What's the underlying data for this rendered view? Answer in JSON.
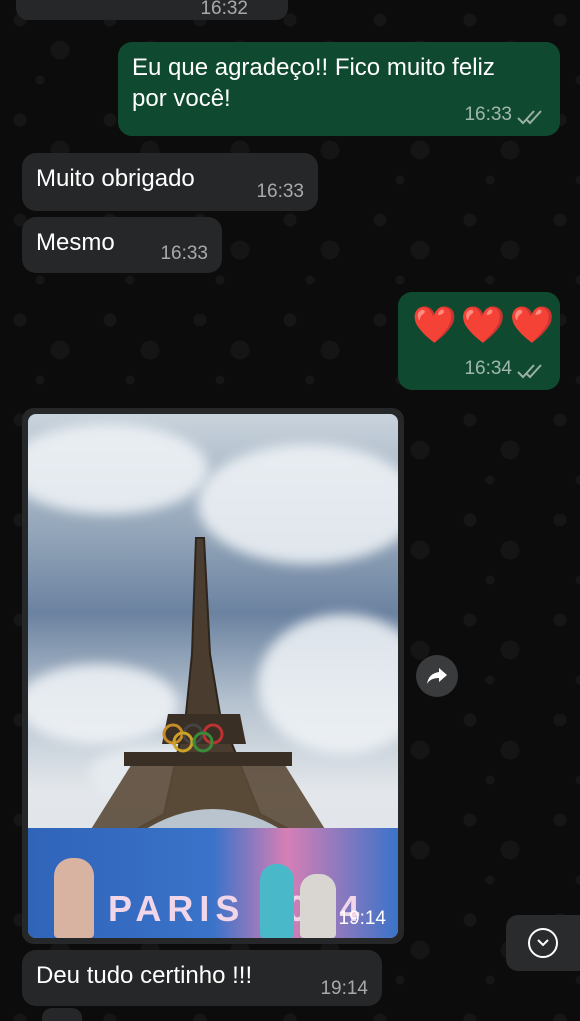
{
  "messages": [
    {
      "id": "m0",
      "direction": "in",
      "time": "16:32"
    },
    {
      "id": "m1",
      "direction": "out",
      "text_line1": "Eu que agradeço!! Fico muito feliz",
      "text_line2": "por você!",
      "time": "16:33",
      "status": "read"
    },
    {
      "id": "m2",
      "direction": "in",
      "text": "Muito obrigado",
      "time": "16:33"
    },
    {
      "id": "m3",
      "direction": "in",
      "text": "Mesmo",
      "time": "16:33"
    },
    {
      "id": "m4",
      "direction": "out",
      "text": "❤️❤️❤️",
      "time": "16:34",
      "status": "read"
    },
    {
      "id": "m5",
      "direction": "in",
      "type": "photo",
      "photo_caption_text": "PARIS 2024",
      "time": "19:14"
    },
    {
      "id": "m6",
      "direction": "in",
      "text": "Deu tudo certinho !!!",
      "time": "19:14"
    }
  ],
  "colors": {
    "outgoing_bubble": "#0f4a30",
    "incoming_bubble": "#262728",
    "background": "#0b0b0b",
    "read_ticks": "#9bb0a5"
  },
  "icons": {
    "forward": "forward-icon",
    "scroll_down": "chevron-down-icon",
    "read_receipt": "double-check-icon"
  }
}
